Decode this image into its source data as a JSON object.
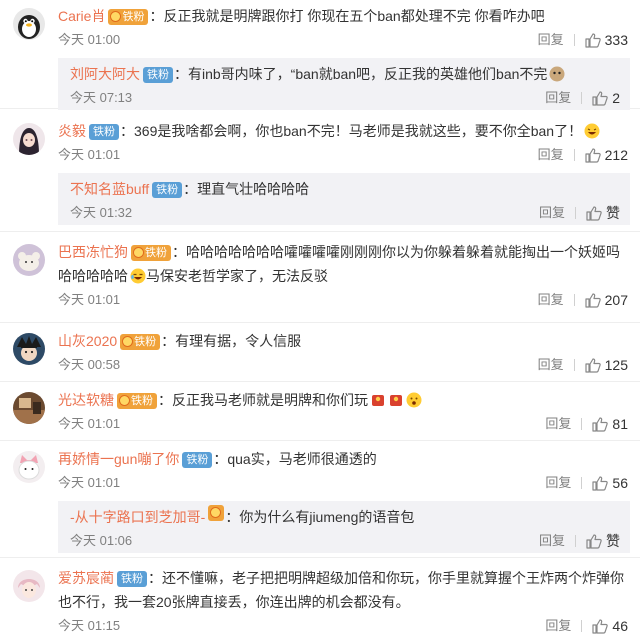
{
  "actions": {
    "reply_label": "回复",
    "like_label": "赞"
  },
  "comments": [
    {
      "user": "Carie肖",
      "badge": "铁粉",
      "badge_style": "gold",
      "text": "：反正我就是明牌跟你打 你现在五个ban都处理不完 你看咋办吧",
      "time": "今天 01:00",
      "likes": "333",
      "avatar_icon": "penguin-avatar-icon",
      "reply": {
        "user": "刘阿大阿大",
        "badge": "铁粉",
        "badge_style": "blue",
        "text": "：有inb哥内味了，“ban就ban吧，反正我的英雄他们ban不完",
        "time": "今天 07:13",
        "likes": "2"
      }
    },
    {
      "user": "炎毅",
      "badge": "铁粉",
      "badge_style": "blue",
      "text": "：369是我啥都会啊，你也ban不完！马老师是我就这些，要不你全ban了！",
      "time": "今天 01:01",
      "likes": "212",
      "avatar_icon": "anime-girl-avatar-icon",
      "reply": {
        "user": "不知名蓝buff",
        "badge": "铁粉",
        "badge_style": "blue",
        "text": "：理直气壮哈哈哈哈",
        "time": "今天 01:32",
        "likes": "赞"
      }
    },
    {
      "user": "巴西冻忙狗",
      "badge": "铁粉",
      "badge_style": "gold",
      "text": "：哈哈哈哈哈哈哈嚯嚯嚯嚯刚刚刚你以为你躲着躲着就能掏出一个妖姬吗哈哈哈哈哈",
      "text2": "马保安老哲学家了，无法反驳",
      "time": "今天 01:01",
      "likes": "207",
      "avatar_icon": "plush-avatar-icon"
    },
    {
      "user": "山灰2020",
      "badge": "铁粉",
      "badge_style": "gold",
      "text": "：有理有据，令人信服",
      "time": "今天 00:58",
      "likes": "125",
      "avatar_icon": "cartoon-avatar-icon"
    },
    {
      "user": "光达软糖",
      "badge": "铁粉",
      "badge_style": "gold",
      "text": "：反正我马老师就是明牌和你们玩",
      "time": "今天 01:01",
      "likes": "81",
      "avatar_icon": "room-avatar-icon"
    },
    {
      "user": "再娇情一gun嘣了你",
      "badge": "铁粉",
      "badge_style": "blue",
      "text": "：qua实，马老师很通透的",
      "time": "今天 01:01",
      "likes": "56",
      "avatar_icon": "cat-avatar-icon",
      "reply": {
        "user": "-从十字路口到芝加哥-",
        "badge": "",
        "badge_style": "gold",
        "text": "：你为什么有jiumeng的语音包",
        "time": "今天 01:06",
        "likes": "赞"
      }
    },
    {
      "user": "爱苏宸蔺",
      "badge": "铁粉",
      "badge_style": "blue",
      "text": "：还不懂嘛，老子把把明牌超级加倍和你玩，你手里就算握个王炸两个炸弹你也不行，我一套20张牌直接丢，你连出牌的机会都没有。",
      "time": "今天 01:15",
      "likes": "46",
      "avatar_icon": "anime-boy-avatar-icon"
    }
  ]
}
